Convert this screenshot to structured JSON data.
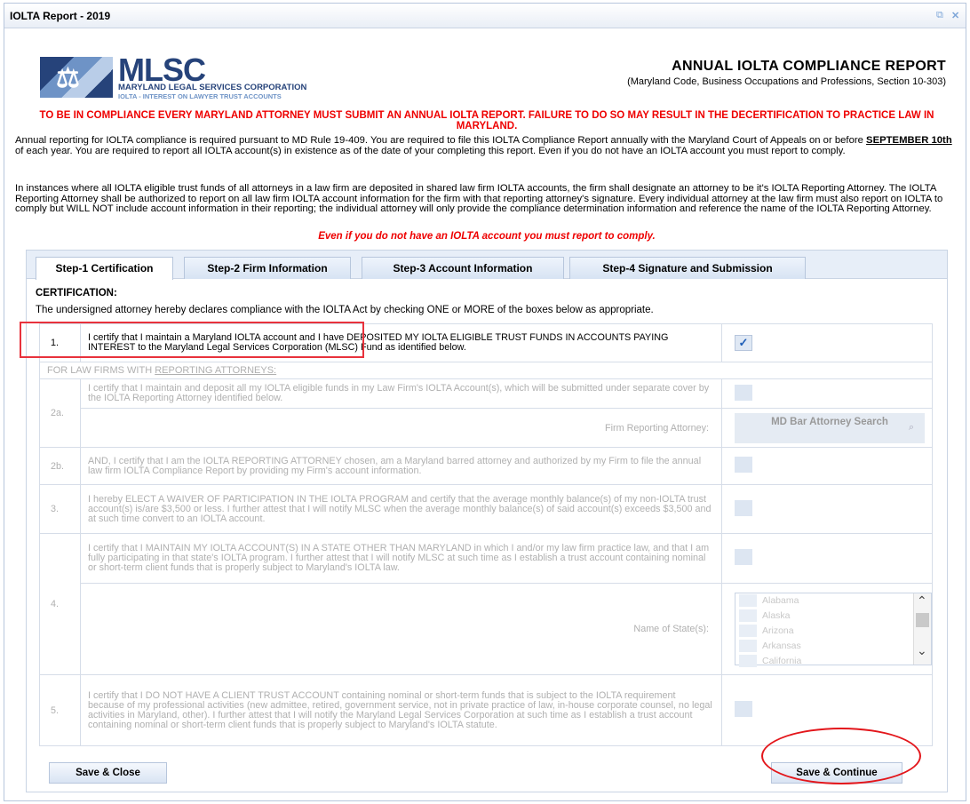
{
  "window": {
    "title": "IOLTA Report - 2019"
  },
  "logo": {
    "mark": "MLSC",
    "line1": "MARYLAND LEGAL SERVICES CORPORATION",
    "line2": "IOLTA - INTEREST ON LAWYER TRUST ACCOUNTS"
  },
  "header": {
    "title": "ANNUAL IOLTA COMPLIANCE REPORT",
    "subtitle": "(Maryland Code, Business Occupations and Professions, Section 10-303)"
  },
  "warning": "TO BE IN COMPLIANCE EVERY MARYLAND ATTORNEY MUST SUBMIT AN ANNUAL IOLTA REPORT. FAILURE TO DO SO MAY RESULT IN THE DECERTIFICATION TO PRACTICE LAW IN MARYLAND.",
  "para1": {
    "a": "Annual reporting for IOLTA compliance is required pursuant to MD Rule 19-409. You are required to file this IOLTA Compliance Report annually with the Maryland Court of Appeals on or before ",
    "date": "SEPTEMBER 10th",
    "b": " of each year. You are required to report all IOLTA account(s) in existence as of the date of your completing this report. Even if you do not have an IOLTA account you must report to comply."
  },
  "para2": "In instances where all IOLTA eligible trust funds of all attorneys in a law firm are deposited in shared law firm IOLTA accounts, the firm shall designate an attorney to be it's IOLTA Reporting Attorney. The IOLTA Reporting Attorney shall be authorized to report on all law firm IOLTA account information for the firm with that reporting attorney's signature. Every individual attorney at the law firm must also report on IOLTA to comply but WILL NOT include account information in their reporting; the individual attorney will only provide the compliance determination information and reference the name of the IOLTA Reporting Attorney.",
  "reminder": "Even if you do not have an IOLTA account you must report to comply.",
  "tabs": [
    {
      "label": "Step-1 Certification"
    },
    {
      "label": "Step-2 Firm Information"
    },
    {
      "label": "Step-3 Account Information"
    },
    {
      "label": "Step-4 Signature and Submission"
    }
  ],
  "certification": {
    "heading": "CERTIFICATION:",
    "description": "The undersigned attorney hereby declares compliance with the IOLTA Act by checking ONE or MORE of the boxes below as appropriate.",
    "row1": {
      "num": "1.",
      "text": "I certify that I maintain a Maryland IOLTA account and I have DEPOSITED MY IOLTA ELIGIBLE TRUST FUNDS IN ACCOUNTS PAYING INTEREST to the Maryland Legal Services Corporation (MLSC) Fund as identified below.",
      "checked": true
    },
    "section_prefix": "FOR LAW FIRMS WITH ",
    "section_underlined": "REPORTING ATTORNEYS:",
    "row2a": {
      "num": "2a.",
      "text": "I certify that I maintain and deposit all my IOLTA eligible funds in my Law Firm's IOLTA Account(s), which will be submitted under separate cover by the IOLTA Reporting Attorney identified below.",
      "field_label": "Firm Reporting Attorney:",
      "search_label": "MD Bar Attorney Search"
    },
    "row2b": {
      "num": "2b.",
      "text": "AND, I certify that I am the IOLTA REPORTING ATTORNEY chosen, am a Maryland barred attorney and authorized by my Firm to file the annual law firm IOLTA Compliance Report by providing my Firm's account information."
    },
    "row3": {
      "num": "3.",
      "text": "I hereby ELECT A WAIVER OF PARTICIPATION IN THE IOLTA PROGRAM and certify that the average monthly balance(s) of my non-IOLTA trust account(s) is/are $3,500 or less. I further attest that I will notify MLSC when the average monthly balance(s) of said account(s) exceeds $3,500 and at such time convert to an IOLTA account."
    },
    "row4": {
      "num": "4.",
      "text": "I certify that I MAINTAIN MY IOLTA ACCOUNT(S) IN A STATE OTHER THAN MARYLAND in which I and/or my law firm practice law, and that I am fully participating in that state's IOLTA program. I further attest that I will notify MLSC at such time as I establish a trust account containing nominal or short-term client funds that is properly subject to Maryland's IOLTA law.",
      "field_label": "Name of State(s):",
      "states": [
        "Alabama",
        "Alaska",
        "Arizona",
        "Arkansas",
        "California"
      ]
    },
    "row5": {
      "num": "5.",
      "text": "I certify that I DO NOT HAVE A CLIENT TRUST ACCOUNT containing nominal or short-term funds that is subject to the IOLTA requirement because of my professional activities (new admittee, retired, government service, not in private practice of law, in-house corporate counsel, no legal activities in Maryland, other). I further attest that I will notify the Maryland Legal Services Corporation at such time as I establish a trust account containing nominal or short-term client funds that is properly subject to Maryland's IOLTA statute."
    }
  },
  "buttons": {
    "save_close": "Save & Close",
    "save_continue": "Save & Continue"
  },
  "icons": {
    "checkmark": "checkmark-icon",
    "magnifier": "search-icon",
    "restore": "restore-icon",
    "close": "close-icon"
  }
}
